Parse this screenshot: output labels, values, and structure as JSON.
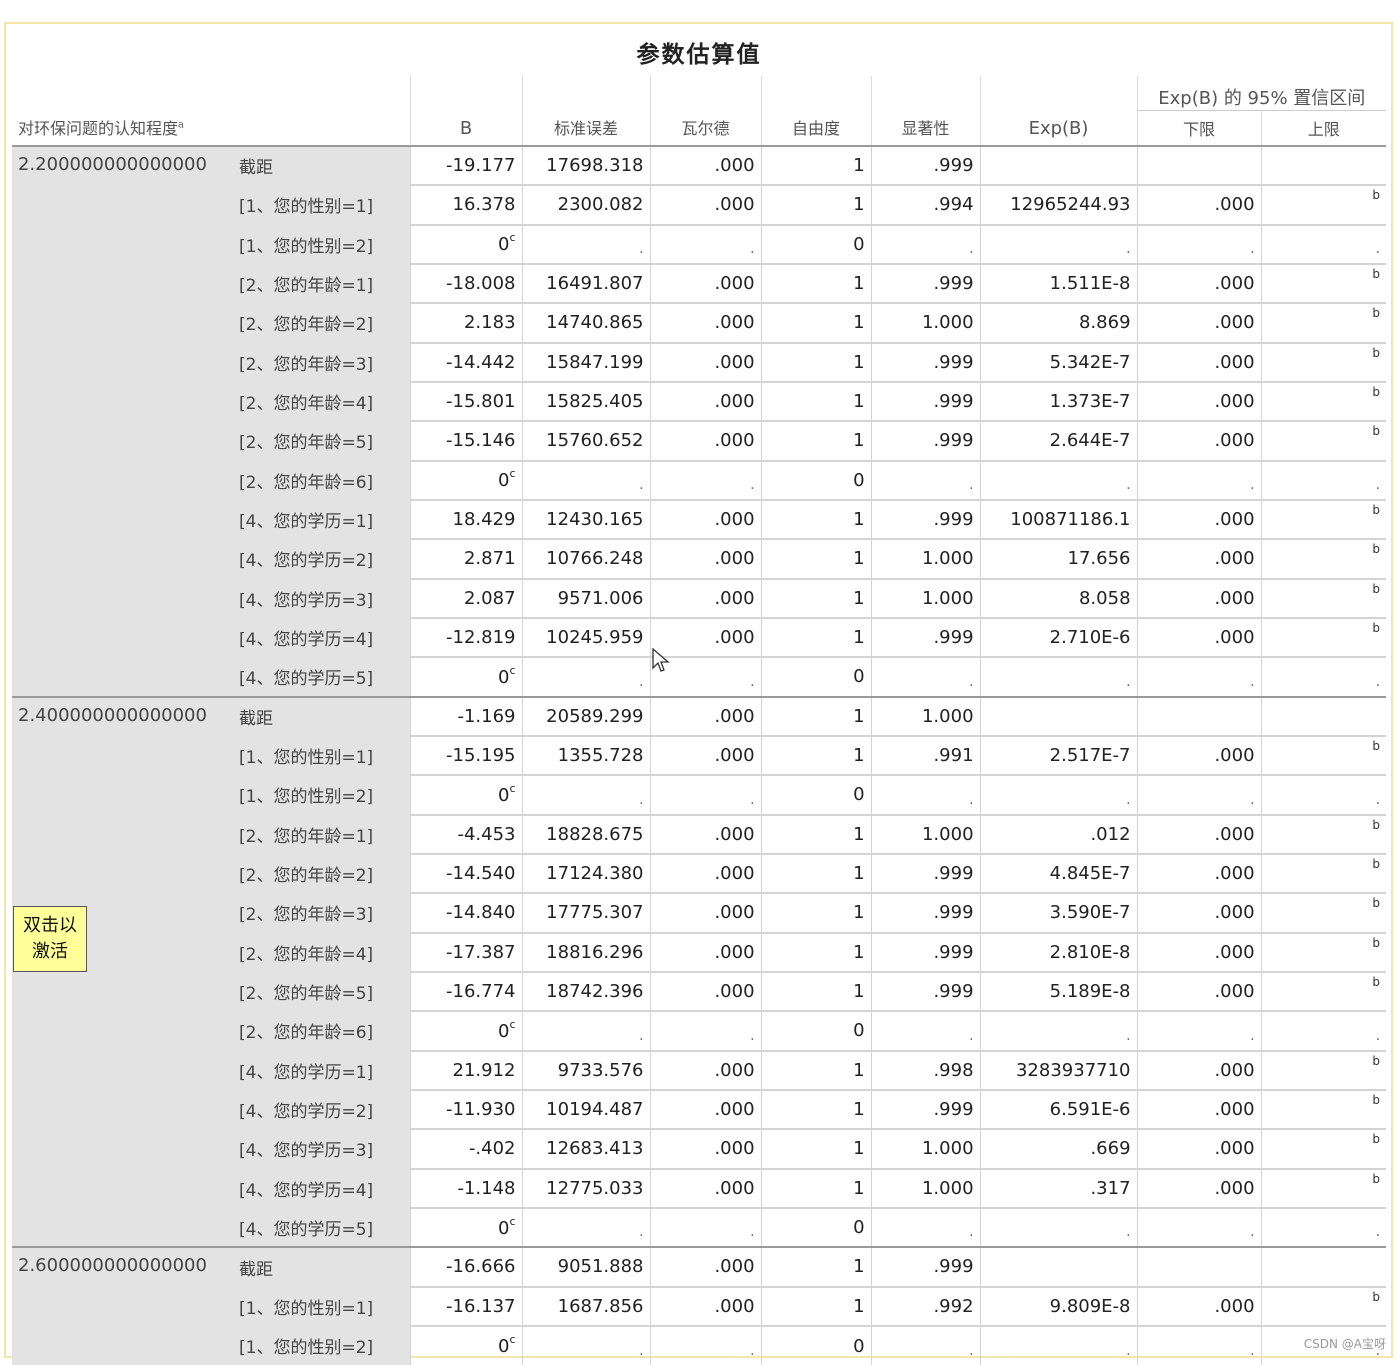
{
  "title": "参数估算值",
  "header": {
    "dep_var": "对环保问题的认知程度",
    "dep_sup": "a",
    "b": "B",
    "se": "标准误差",
    "wald": "瓦尔德",
    "df": "自由度",
    "sig": "显著性",
    "expb": "Exp(B)",
    "ci": "Exp(B) 的 95% 置信区间",
    "lower": "下限",
    "upper": "上限"
  },
  "groups": [
    {
      "label": "2.200000000000000",
      "rows": [
        {
          "param": "截距",
          "b": "-19.177",
          "se": "17698.318",
          "wald": ".000",
          "df": "1",
          "sig": ".999",
          "expb": "",
          "lower": "",
          "upper": ""
        },
        {
          "param": "[1、您的性别=1]",
          "b": "16.378",
          "se": "2300.082",
          "wald": ".000",
          "df": "1",
          "sig": ".994",
          "expb": "12965244.93",
          "lower": ".000",
          "upper": "b"
        },
        {
          "param": "[1、您的性别=2]",
          "b": "0",
          "bsup": "c",
          "se": ".",
          "wald": ".",
          "df": "0",
          "sig": ".",
          "expb": ".",
          "lower": ".",
          "upper": "."
        },
        {
          "param": "[2、您的年龄=1]",
          "b": "-18.008",
          "se": "16491.807",
          "wald": ".000",
          "df": "1",
          "sig": ".999",
          "expb": "1.511E-8",
          "lower": ".000",
          "upper": "b"
        },
        {
          "param": "[2、您的年龄=2]",
          "b": "2.183",
          "se": "14740.865",
          "wald": ".000",
          "df": "1",
          "sig": "1.000",
          "expb": "8.869",
          "lower": ".000",
          "upper": "b"
        },
        {
          "param": "[2、您的年龄=3]",
          "b": "-14.442",
          "se": "15847.199",
          "wald": ".000",
          "df": "1",
          "sig": ".999",
          "expb": "5.342E-7",
          "lower": ".000",
          "upper": "b"
        },
        {
          "param": "[2、您的年龄=4]",
          "b": "-15.801",
          "se": "15825.405",
          "wald": ".000",
          "df": "1",
          "sig": ".999",
          "expb": "1.373E-7",
          "lower": ".000",
          "upper": "b"
        },
        {
          "param": "[2、您的年龄=5]",
          "b": "-15.146",
          "se": "15760.652",
          "wald": ".000",
          "df": "1",
          "sig": ".999",
          "expb": "2.644E-7",
          "lower": ".000",
          "upper": "b"
        },
        {
          "param": "[2、您的年龄=6]",
          "b": "0",
          "bsup": "c",
          "se": ".",
          "wald": ".",
          "df": "0",
          "sig": ".",
          "expb": ".",
          "lower": ".",
          "upper": "."
        },
        {
          "param": "[4、您的学历=1]",
          "b": "18.429",
          "se": "12430.165",
          "wald": ".000",
          "df": "1",
          "sig": ".999",
          "expb": "100871186.1",
          "lower": ".000",
          "upper": "b"
        },
        {
          "param": "[4、您的学历=2]",
          "b": "2.871",
          "se": "10766.248",
          "wald": ".000",
          "df": "1",
          "sig": "1.000",
          "expb": "17.656",
          "lower": ".000",
          "upper": "b"
        },
        {
          "param": "[4、您的学历=3]",
          "b": "2.087",
          "se": "9571.006",
          "wald": ".000",
          "df": "1",
          "sig": "1.000",
          "expb": "8.058",
          "lower": ".000",
          "upper": "b"
        },
        {
          "param": "[4、您的学历=4]",
          "b": "-12.819",
          "se": "10245.959",
          "wald": ".000",
          "df": "1",
          "sig": ".999",
          "expb": "2.710E-6",
          "lower": ".000",
          "upper": "b"
        },
        {
          "param": "[4、您的学历=5]",
          "b": "0",
          "bsup": "c",
          "se": ".",
          "wald": ".",
          "df": "0",
          "sig": ".",
          "expb": ".",
          "lower": ".",
          "upper": "."
        }
      ]
    },
    {
      "label": "2.400000000000000",
      "rows": [
        {
          "param": "截距",
          "b": "-1.169",
          "se": "20589.299",
          "wald": ".000",
          "df": "1",
          "sig": "1.000",
          "expb": "",
          "lower": "",
          "upper": ""
        },
        {
          "param": "[1、您的性别=1]",
          "b": "-15.195",
          "se": "1355.728",
          "wald": ".000",
          "df": "1",
          "sig": ".991",
          "expb": "2.517E-7",
          "lower": ".000",
          "upper": "b"
        },
        {
          "param": "[1、您的性别=2]",
          "b": "0",
          "bsup": "c",
          "se": ".",
          "wald": ".",
          "df": "0",
          "sig": ".",
          "expb": ".",
          "lower": ".",
          "upper": "."
        },
        {
          "param": "[2、您的年龄=1]",
          "b": "-4.453",
          "se": "18828.675",
          "wald": ".000",
          "df": "1",
          "sig": "1.000",
          "expb": ".012",
          "lower": ".000",
          "upper": "b"
        },
        {
          "param": "[2、您的年龄=2]",
          "b": "-14.540",
          "se": "17124.380",
          "wald": ".000",
          "df": "1",
          "sig": ".999",
          "expb": "4.845E-7",
          "lower": ".000",
          "upper": "b"
        },
        {
          "param": "[2、您的年龄=3]",
          "b": "-14.840",
          "se": "17775.307",
          "wald": ".000",
          "df": "1",
          "sig": ".999",
          "expb": "3.590E-7",
          "lower": ".000",
          "upper": "b"
        },
        {
          "param": "[2、您的年龄=4]",
          "b": "-17.387",
          "se": "18816.296",
          "wald": ".000",
          "df": "1",
          "sig": ".999",
          "expb": "2.810E-8",
          "lower": ".000",
          "upper": "b"
        },
        {
          "param": "[2、您的年龄=5]",
          "b": "-16.774",
          "se": "18742.396",
          "wald": ".000",
          "df": "1",
          "sig": ".999",
          "expb": "5.189E-8",
          "lower": ".000",
          "upper": "b"
        },
        {
          "param": "[2、您的年龄=6]",
          "b": "0",
          "bsup": "c",
          "se": ".",
          "wald": ".",
          "df": "0",
          "sig": ".",
          "expb": ".",
          "lower": ".",
          "upper": "."
        },
        {
          "param": "[4、您的学历=1]",
          "b": "21.912",
          "se": "9733.576",
          "wald": ".000",
          "df": "1",
          "sig": ".998",
          "expb": "3283937710",
          "lower": ".000",
          "upper": "b"
        },
        {
          "param": "[4、您的学历=2]",
          "b": "-11.930",
          "se": "10194.487",
          "wald": ".000",
          "df": "1",
          "sig": ".999",
          "expb": "6.591E-6",
          "lower": ".000",
          "upper": "b"
        },
        {
          "param": "[4、您的学历=3]",
          "b": "-.402",
          "se": "12683.413",
          "wald": ".000",
          "df": "1",
          "sig": "1.000",
          "expb": ".669",
          "lower": ".000",
          "upper": "b"
        },
        {
          "param": "[4、您的学历=4]",
          "b": "-1.148",
          "se": "12775.033",
          "wald": ".000",
          "df": "1",
          "sig": "1.000",
          "expb": ".317",
          "lower": ".000",
          "upper": "b"
        },
        {
          "param": "[4、您的学历=5]",
          "b": "0",
          "bsup": "c",
          "se": ".",
          "wald": ".",
          "df": "0",
          "sig": ".",
          "expb": ".",
          "lower": ".",
          "upper": "."
        }
      ]
    },
    {
      "label": "2.600000000000000",
      "rows": [
        {
          "param": "截距",
          "b": "-16.666",
          "se": "9051.888",
          "wald": ".000",
          "df": "1",
          "sig": ".999",
          "expb": "",
          "lower": "",
          "upper": ""
        },
        {
          "param": "[1、您的性别=1]",
          "b": "-16.137",
          "se": "1687.856",
          "wald": ".000",
          "df": "1",
          "sig": ".992",
          "expb": "9.809E-8",
          "lower": ".000",
          "upper": "b"
        },
        {
          "param": "[1、您的性别=2]",
          "b": "0",
          "bsup": "c",
          "se": ".",
          "wald": ".",
          "df": "0",
          "sig": ".",
          "expb": ".",
          "lower": ".",
          "upper": "."
        }
      ]
    }
  ],
  "tooltip": {
    "line1": "双击以",
    "line2": "激活"
  },
  "watermark": "CSDN @A宝呀"
}
